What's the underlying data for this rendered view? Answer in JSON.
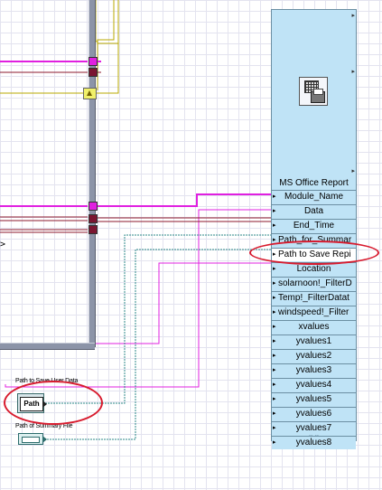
{
  "node": {
    "title": "MS Office Report",
    "icon": "ms-office-report-icon",
    "terminals": [
      {
        "label": "Module_Name"
      },
      {
        "label": "Data"
      },
      {
        "label": "End_Time"
      },
      {
        "label": "Path_for_Summar"
      },
      {
        "label": "Path to Save Repi"
      },
      {
        "label": "Location"
      },
      {
        "label": "solarnoon!_FilterD"
      },
      {
        "label": "Temp!_FilterDatat"
      },
      {
        "label": "windspeed!_Filter"
      },
      {
        "label": "xvalues"
      },
      {
        "label": "yvalues1"
      },
      {
        "label": "yvalues2"
      },
      {
        "label": "yvalues3"
      },
      {
        "label": "yvalues4"
      },
      {
        "label": "yvalues5"
      },
      {
        "label": "yvalues6"
      },
      {
        "label": "yvalues7"
      },
      {
        "label": "yvalues8"
      }
    ]
  },
  "controls": {
    "path_save_label": "Path to Save User Data",
    "path_control_text": "Path",
    "path_summary_label": "Path of Summary File"
  },
  "misc": {
    "cut_glyph": ">"
  },
  "colors": {
    "wire_pink": "#e020e0",
    "wire_dark_red": "#8c1a2c",
    "wire_teal": "#2d8a8a",
    "wire_yellow": "#b8a800",
    "highlight_red": "#d81b2e"
  }
}
